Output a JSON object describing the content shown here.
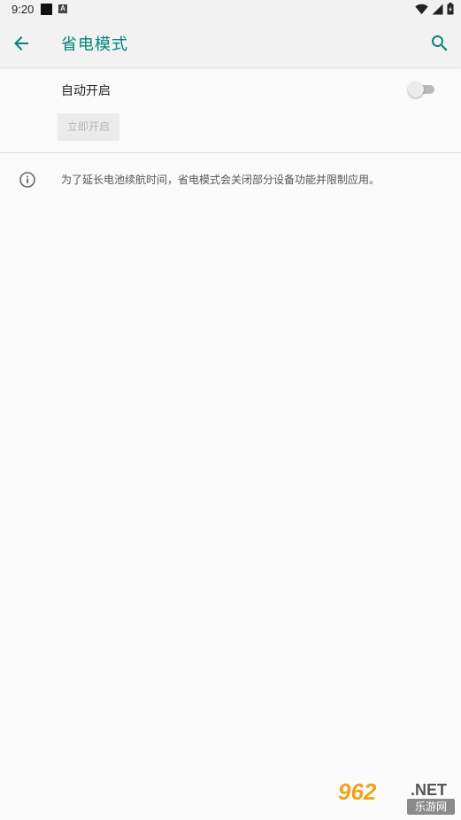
{
  "status_bar": {
    "time": "9:20",
    "badge_letter": "A"
  },
  "app_bar": {
    "title": "省电模式",
    "back_icon": "arrow-left-icon",
    "search_icon": "search-icon"
  },
  "auto": {
    "label": "自动开启",
    "toggle_on": false
  },
  "turn_on_button": {
    "label": "立即开启",
    "enabled": false
  },
  "info": {
    "icon": "info-icon",
    "text": "为了延长电池续航时间，省电模式会关闭部分设备功能并限制应用。"
  },
  "watermark": {
    "number": "962",
    "domain": ".NET",
    "site_name": "乐游网"
  },
  "colors": {
    "accent": "#008577",
    "background": "#fafafa",
    "app_bar": "#f2f2f2"
  }
}
